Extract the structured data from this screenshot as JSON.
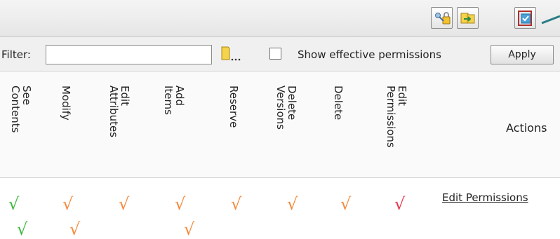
{
  "toolbar": {
    "buttons": [
      {
        "name": "view-permissions-button",
        "icon": "key-lock-icon"
      },
      {
        "name": "copy-permissions-button",
        "icon": "users-arrow-icon"
      },
      {
        "name": "inherit-permissions-button",
        "icon": "document-check-icon"
      }
    ]
  },
  "filter": {
    "label": "Filter:",
    "value": "",
    "browse_icon": "browse-folder-icon",
    "show_effective_label": "Show effective permissions",
    "show_effective_checked": false,
    "apply_label": "Apply"
  },
  "columns": [
    "See\nContents",
    "Modify",
    "Edit\nAttributes",
    "Add\nItems",
    "Reserve",
    "Delete\nVersions",
    "Delete",
    "Edit\nPermissions"
  ],
  "actions_header": "Actions",
  "rows": [
    {
      "checks": [
        "√",
        "√",
        "√",
        "√",
        "√",
        "√",
        "√",
        "√"
      ],
      "check_colors": [
        "#3db83d",
        "#f58a3c",
        "#f58a3c",
        "#f58a3c",
        "#f58a3c",
        "#f58a3c",
        "#f58a3c",
        "#e8354a"
      ],
      "action_link": "Edit Permissions"
    },
    {
      "checks": [
        "√",
        "√",
        "",
        "√",
        "",
        "",
        "",
        ""
      ],
      "check_colors": [
        "#3db83d",
        "#f58a3c",
        "#f58a3c",
        "#f58a3c",
        "#f58a3c",
        "#f58a3c",
        "#f58a3c",
        "#e8354a"
      ],
      "action_link": ""
    }
  ],
  "colors": {
    "allow_green": "#3db83d",
    "allow_orange": "#f58a3c",
    "allow_red": "#e8354a",
    "callout": "#2a7d85"
  }
}
